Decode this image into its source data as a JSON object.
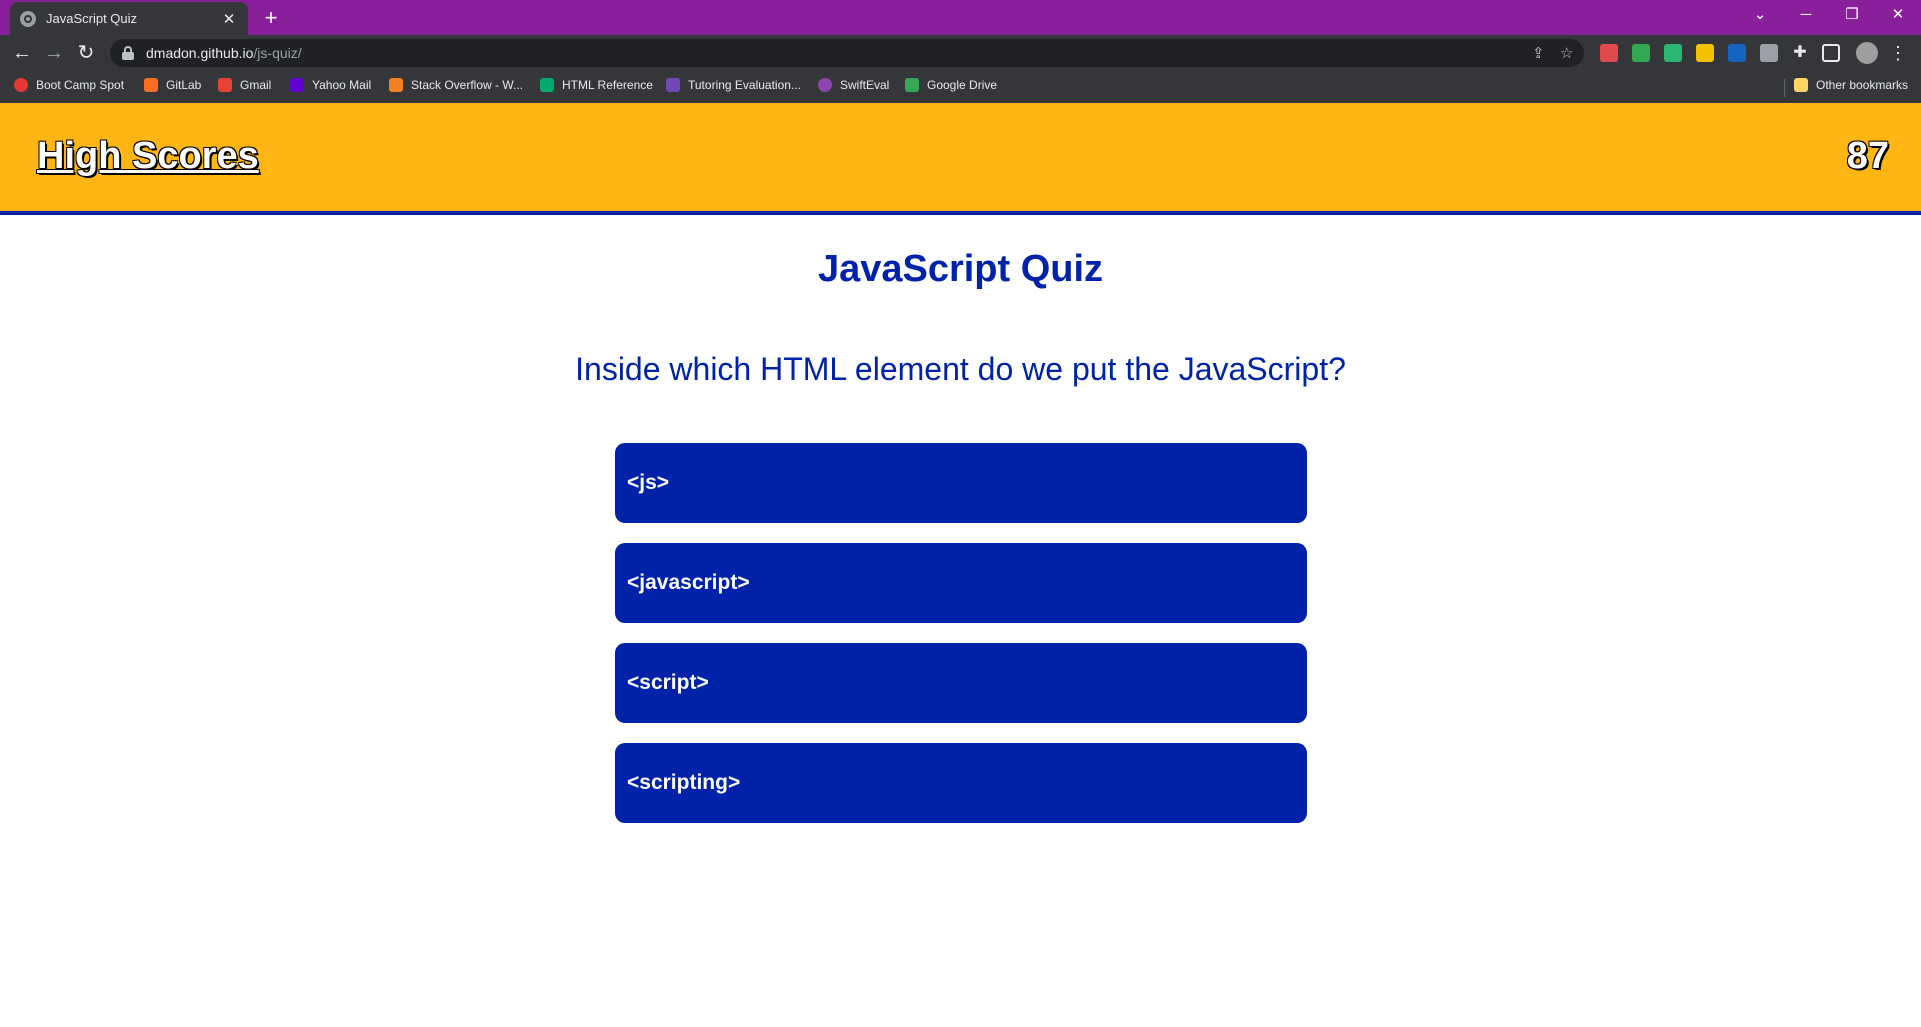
{
  "browser": {
    "tab_title": "JavaScript Quiz",
    "url_host": "dmadon.github.io",
    "url_path": "/js-quiz/",
    "bookmarks": [
      {
        "label": "Boot Camp Spot",
        "color": "#e53935"
      },
      {
        "label": "GitLab",
        "color": "#fc6d26"
      },
      {
        "label": "Gmail",
        "color": "#ea4335"
      },
      {
        "label": "Yahoo Mail",
        "color": "#6001d2"
      },
      {
        "label": "Stack Overflow - W...",
        "color": "#f48024"
      },
      {
        "label": "HTML Reference",
        "color": "#04aa6d"
      },
      {
        "label": "Tutoring Evaluation...",
        "color": "#7248b9"
      },
      {
        "label": "SwiftEval",
        "color": "#8e44ad"
      },
      {
        "label": "Google Drive",
        "color": "#34a853"
      }
    ],
    "other_bookmarks": "Other bookmarks"
  },
  "page": {
    "high_scores_label": "High Scores",
    "timer": "87",
    "title": "JavaScript Quiz",
    "question": "Inside which HTML element do we put the JavaScript?",
    "answers": [
      "<js>",
      "<javascript>",
      "<script>",
      "<scripting>"
    ]
  },
  "colors": {
    "header_bg": "#ffb612",
    "brand_blue": "#0022a8",
    "titlebar": "#8a1f9b"
  }
}
